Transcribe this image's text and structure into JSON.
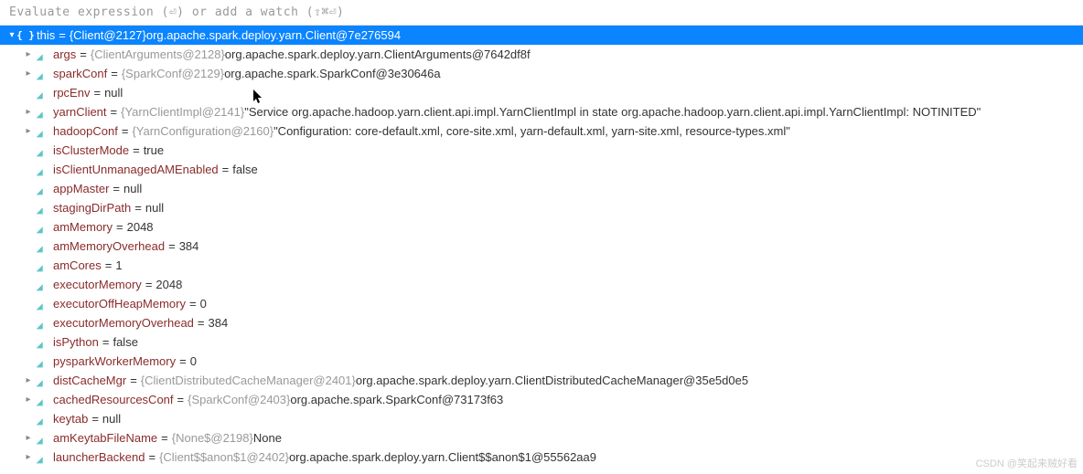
{
  "eval_placeholder": "Evaluate expression (⏎) or add a watch (⇧⌘⏎)",
  "watermark": "CSDN @笑起来贼好看",
  "root": {
    "name": "this",
    "type": "{Client@2127}",
    "value": "org.apache.spark.deploy.yarn.Client@7e276594"
  },
  "fields": [
    {
      "name": "args",
      "type": "{ClientArguments@2128}",
      "value": "org.apache.spark.deploy.yarn.ClientArguments@7642df8f",
      "expandable": true,
      "icon": "tag"
    },
    {
      "name": "sparkConf",
      "type": "{SparkConf@2129}",
      "value": "org.apache.spark.SparkConf@3e30646a",
      "expandable": true,
      "icon": "tag"
    },
    {
      "name": "rpcEnv",
      "type": null,
      "value": "null",
      "expandable": false,
      "icon": "tag"
    },
    {
      "name": "yarnClient",
      "type": "{YarnClientImpl@2141}",
      "value": "\"Service org.apache.hadoop.yarn.client.api.impl.YarnClientImpl in state org.apache.hadoop.yarn.client.api.impl.YarnClientImpl: NOTINITED\"",
      "expandable": true,
      "icon": "tag"
    },
    {
      "name": "hadoopConf",
      "type": "{YarnConfiguration@2160}",
      "value": "\"Configuration: core-default.xml, core-site.xml, yarn-default.xml, yarn-site.xml, resource-types.xml\"",
      "expandable": true,
      "icon": "tag"
    },
    {
      "name": "isClusterMode",
      "type": null,
      "value": "true",
      "expandable": false,
      "icon": "tag"
    },
    {
      "name": "isClientUnmanagedAMEnabled",
      "type": null,
      "value": "false",
      "expandable": false,
      "icon": "tag"
    },
    {
      "name": "appMaster",
      "type": null,
      "value": "null",
      "expandable": false,
      "icon": "tag"
    },
    {
      "name": "stagingDirPath",
      "type": null,
      "value": "null",
      "expandable": false,
      "icon": "tag"
    },
    {
      "name": "amMemory",
      "type": null,
      "value": "2048",
      "expandable": false,
      "icon": "tag"
    },
    {
      "name": "amMemoryOverhead",
      "type": null,
      "value": "384",
      "expandable": false,
      "icon": "tag"
    },
    {
      "name": "amCores",
      "type": null,
      "value": "1",
      "expandable": false,
      "icon": "tag"
    },
    {
      "name": "executorMemory",
      "type": null,
      "value": "2048",
      "expandable": false,
      "icon": "tag"
    },
    {
      "name": "executorOffHeapMemory",
      "type": null,
      "value": "0",
      "expandable": false,
      "icon": "tag"
    },
    {
      "name": "executorMemoryOverhead",
      "type": null,
      "value": "384",
      "expandable": false,
      "icon": "tag"
    },
    {
      "name": "isPython",
      "type": null,
      "value": "false",
      "expandable": false,
      "icon": "tag"
    },
    {
      "name": "pysparkWorkerMemory",
      "type": null,
      "value": "0",
      "expandable": false,
      "icon": "tag"
    },
    {
      "name": "distCacheMgr",
      "type": "{ClientDistributedCacheManager@2401}",
      "value": "org.apache.spark.deploy.yarn.ClientDistributedCacheManager@35e5d0e5",
      "expandable": true,
      "icon": "tag"
    },
    {
      "name": "cachedResourcesConf",
      "type": "{SparkConf@2403}",
      "value": "org.apache.spark.SparkConf@73173f63",
      "expandable": true,
      "icon": "tag"
    },
    {
      "name": "keytab",
      "type": null,
      "value": "null",
      "expandable": false,
      "icon": "tag"
    },
    {
      "name": "amKeytabFileName",
      "type": "{None$@2198}",
      "value": "None",
      "expandable": true,
      "icon": "tag"
    },
    {
      "name": "launcherBackend",
      "type": "{Client$$anon$1@2402}",
      "value": "org.apache.spark.deploy.yarn.Client$$anon$1@55562aa9",
      "expandable": true,
      "icon": "tag"
    }
  ]
}
